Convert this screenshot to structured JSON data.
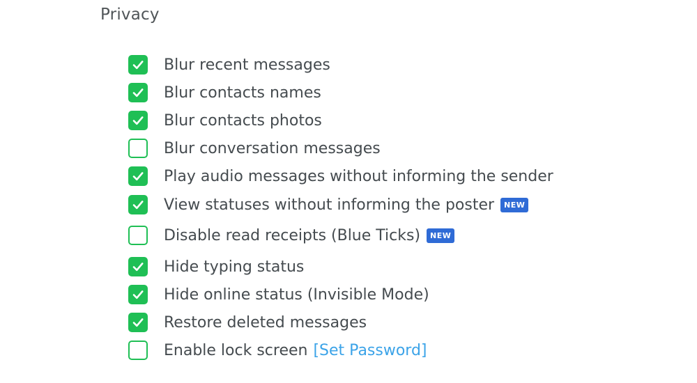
{
  "section": {
    "title": "Privacy"
  },
  "colors": {
    "checkbox_green": "#1fbf55",
    "badge_blue": "#2f6bd6",
    "link_blue": "#3ba3e8"
  },
  "badge_text": "NEW",
  "options": [
    {
      "label": "Blur recent messages",
      "checked": true
    },
    {
      "label": "Blur contacts names",
      "checked": true
    },
    {
      "label": "Blur contacts photos",
      "checked": true
    },
    {
      "label": "Blur conversation messages",
      "checked": false
    },
    {
      "label": "Play audio messages without informing the sender",
      "checked": true
    },
    {
      "label": "View statuses without informing the poster",
      "checked": true,
      "badge": "NEW"
    },
    {
      "label": "Disable read receipts (Blue Ticks)",
      "checked": false,
      "badge": "NEW"
    },
    {
      "label": "Hide typing status",
      "checked": true
    },
    {
      "label": "Hide online status (Invisible Mode)",
      "checked": true
    },
    {
      "label": "Restore deleted messages",
      "checked": true
    },
    {
      "label": "Enable lock screen",
      "checked": false,
      "link": "[Set Password]"
    }
  ]
}
